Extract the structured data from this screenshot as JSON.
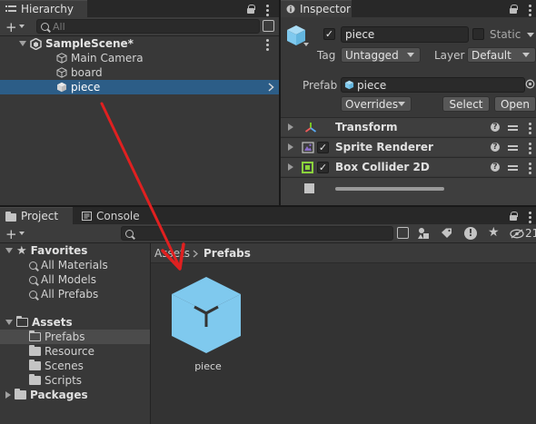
{
  "colors": {
    "accent": "#2c5d87",
    "cube": "#7fc9ee",
    "arrow": "#e02020",
    "panel": "#383838"
  },
  "hierarchy": {
    "tab_label": "Hierarchy",
    "search_placeholder": "All",
    "scene": "SampleScene*",
    "items": [
      {
        "label": "Main Camera"
      },
      {
        "label": "board"
      },
      {
        "label": "piece"
      }
    ]
  },
  "inspector": {
    "tab_label": "Inspector",
    "object_name": "piece",
    "static_label": "Static",
    "tag_label": "Tag",
    "tag_value": "Untagged",
    "layer_label": "Layer",
    "layer_value": "Default",
    "prefab_label": "Prefab",
    "prefab_value": "piece",
    "overrides_label": "Overrides",
    "select_label": "Select",
    "open_label": "Open",
    "components": [
      {
        "name": "Transform",
        "icon": "transform-icon"
      },
      {
        "name": "Sprite Renderer",
        "icon": "sprite-renderer-icon"
      },
      {
        "name": "Box Collider 2D",
        "icon": "box-collider-icon"
      }
    ]
  },
  "project": {
    "tab_label": "Project",
    "console_label": "Console",
    "hidden_count": "21",
    "favorites": {
      "label": "Favorites",
      "items": [
        {
          "label": "All Materials"
        },
        {
          "label": "All Models"
        },
        {
          "label": "All Prefabs"
        }
      ]
    },
    "assets": {
      "label": "Assets",
      "items": [
        {
          "label": "Prefabs"
        },
        {
          "label": "Resource"
        },
        {
          "label": "Scenes"
        },
        {
          "label": "Scripts"
        }
      ]
    },
    "packages_label": "Packages",
    "breadcrumb": [
      "Assets",
      "Prefabs"
    ],
    "files": [
      {
        "label": "piece",
        "icon": "prefab-cube-icon"
      }
    ]
  }
}
